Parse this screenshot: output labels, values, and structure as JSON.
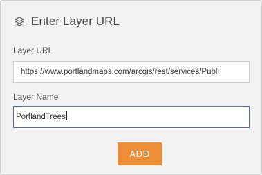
{
  "dialog": {
    "title": "Enter Layer URL",
    "icon": "layers-icon"
  },
  "layer_url": {
    "label": "Layer URL",
    "value": "https://www.portlandmaps.com/arcgis/rest/services/Publi"
  },
  "layer_name": {
    "label": "Layer Name",
    "value": "PortlandTrees"
  },
  "add_button": {
    "label": "ADD",
    "color": "#ec8d37"
  }
}
